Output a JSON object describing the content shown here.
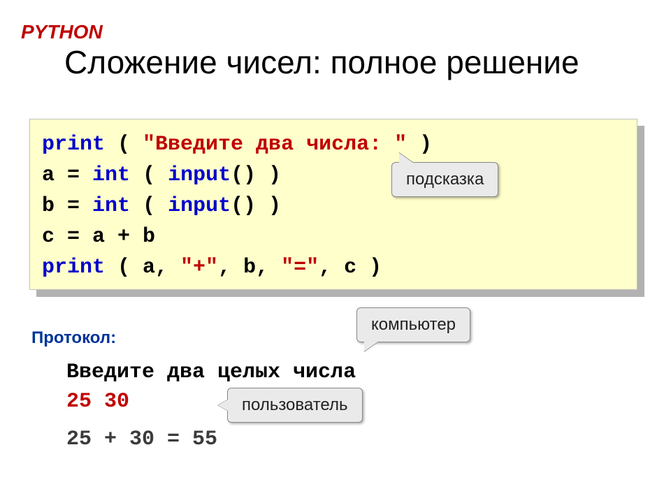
{
  "header": {
    "lang": "PYTHON",
    "title": "Сложение чисел: полное решение"
  },
  "code": {
    "l1_print": "print",
    "l1_open": " ( ",
    "l1_str": "\"Введите два числа: \"",
    "l1_close": " )",
    "l2_a": "a",
    "l2_eq": " = ",
    "l2_int": "int",
    "l2_open": " ( ",
    "l2_input": "input",
    "l2_close": "() )",
    "l3_b": "b",
    "l3_eq": " = ",
    "l3_int": "int",
    "l3_open": " ( ",
    "l3_input": "input",
    "l3_close": "() )",
    "l4": "c = a + b",
    "l5_print": "print",
    "l5_open": " ( a, ",
    "l5_plus": "\"+\"",
    "l5_mid": ", b, ",
    "l5_eqstr": "\"=\"",
    "l5_close": ", c )"
  },
  "callouts": {
    "hint": "подсказка",
    "computer": "компьютер",
    "user": "пользователь"
  },
  "protocol": {
    "label": "Протокол:",
    "line1": "Введите два целых числа",
    "line2": "25 30",
    "line3": "25 + 30 = 55"
  }
}
